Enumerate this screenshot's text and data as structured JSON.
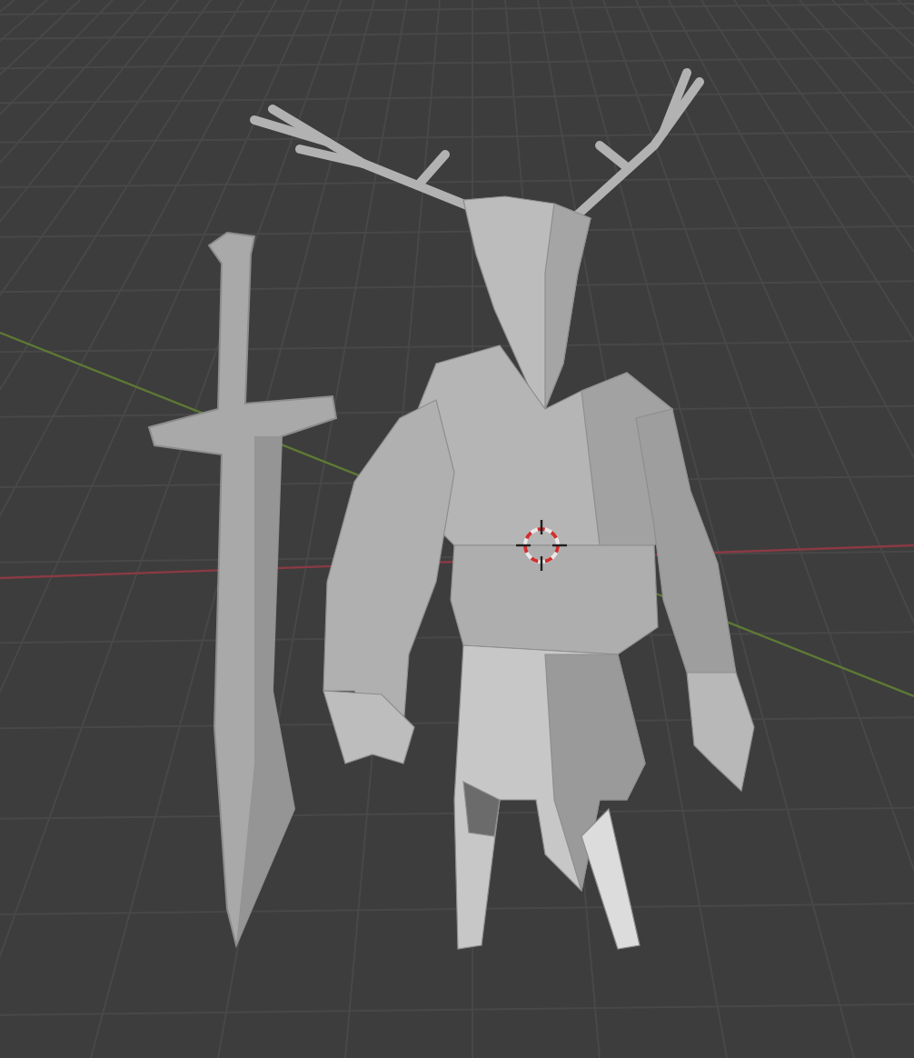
{
  "viewport": {
    "grid": true,
    "axes": true,
    "cursor": true
  }
}
